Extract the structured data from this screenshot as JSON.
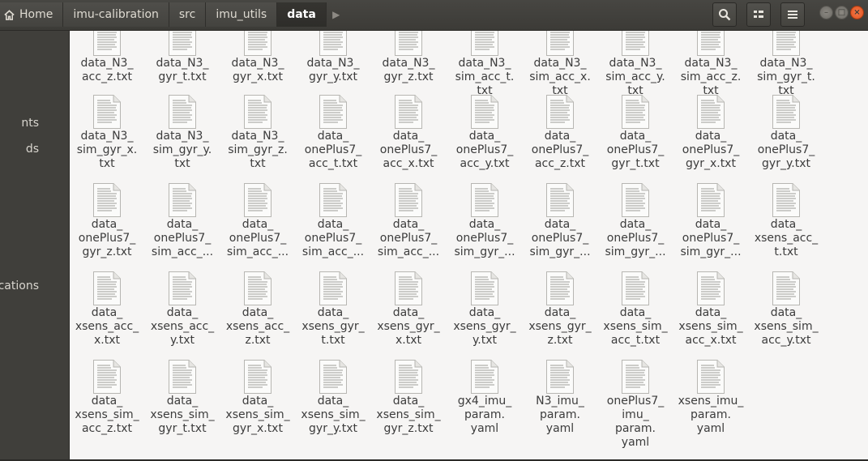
{
  "header": {
    "breadcrumbs": [
      {
        "label": "Home",
        "icon": "home-icon"
      },
      {
        "label": "imu-calibration"
      },
      {
        "label": "src"
      },
      {
        "label": "imu_utils"
      },
      {
        "label": "data",
        "active": true
      }
    ],
    "buttons": [
      {
        "name": "search-button",
        "icon": "search-icon"
      },
      {
        "name": "view-toggle-button",
        "icon": "view-list-icon"
      },
      {
        "name": "menu-button",
        "icon": "hamburger-menu-icon"
      }
    ],
    "window_controls": [
      "minimize",
      "maximize",
      "close"
    ]
  },
  "sidebar": {
    "items": [
      "nts",
      "ds",
      "cations"
    ]
  },
  "files": [
    {
      "label": "data_N3_\nacc_z.txt"
    },
    {
      "label": "data_N3_\ngyr_t.txt"
    },
    {
      "label": "data_N3_\ngyr_x.txt"
    },
    {
      "label": "data_N3_\ngyr_y.txt"
    },
    {
      "label": "data_N3_\ngyr_z.txt"
    },
    {
      "label": "data_N3_\nsim_acc_t.\ntxt"
    },
    {
      "label": "data_N3_\nsim_acc_x.\ntxt"
    },
    {
      "label": "data_N3_\nsim_acc_y.\ntxt"
    },
    {
      "label": "data_N3_\nsim_acc_z.\ntxt"
    },
    {
      "label": "data_N3_\nsim_gyr_t.\ntxt"
    },
    {
      "label": "data_N3_\nsim_gyr_x.\ntxt"
    },
    {
      "label": "data_N3_\nsim_gyr_y.\ntxt"
    },
    {
      "label": "data_N3_\nsim_gyr_z.\ntxt"
    },
    {
      "label": "data_\nonePlus7_\nacc_t.txt"
    },
    {
      "label": "data_\nonePlus7_\nacc_x.txt"
    },
    {
      "label": "data_\nonePlus7_\nacc_y.txt"
    },
    {
      "label": "data_\nonePlus7_\nacc_z.txt"
    },
    {
      "label": "data_\nonePlus7_\ngyr_t.txt"
    },
    {
      "label": "data_\nonePlus7_\ngyr_x.txt"
    },
    {
      "label": "data_\nonePlus7_\ngyr_y.txt"
    },
    {
      "label": "data_\nonePlus7_\ngyr_z.txt"
    },
    {
      "label": "data_\nonePlus7_\nsim_acc_..."
    },
    {
      "label": "data_\nonePlus7_\nsim_acc_..."
    },
    {
      "label": "data_\nonePlus7_\nsim_acc_..."
    },
    {
      "label": "data_\nonePlus7_\nsim_acc_..."
    },
    {
      "label": "data_\nonePlus7_\nsim_gyr_..."
    },
    {
      "label": "data_\nonePlus7_\nsim_gyr_..."
    },
    {
      "label": "data_\nonePlus7_\nsim_gyr_..."
    },
    {
      "label": "data_\nonePlus7_\nsim_gyr_..."
    },
    {
      "label": "data_\nxsens_acc_\nt.txt"
    },
    {
      "label": "data_\nxsens_acc_\nx.txt"
    },
    {
      "label": "data_\nxsens_acc_\ny.txt"
    },
    {
      "label": "data_\nxsens_acc_\nz.txt"
    },
    {
      "label": "data_\nxsens_gyr_\nt.txt"
    },
    {
      "label": "data_\nxsens_gyr_\nx.txt"
    },
    {
      "label": "data_\nxsens_gyr_\ny.txt"
    },
    {
      "label": "data_\nxsens_gyr_\nz.txt"
    },
    {
      "label": "data_\nxsens_sim_\nacc_t.txt"
    },
    {
      "label": "data_\nxsens_sim_\nacc_x.txt"
    },
    {
      "label": "data_\nxsens_sim_\nacc_y.txt"
    },
    {
      "label": "data_\nxsens_sim_\nacc_z.txt"
    },
    {
      "label": "data_\nxsens_sim_\ngyr_t.txt"
    },
    {
      "label": "data_\nxsens_sim_\ngyr_x.txt"
    },
    {
      "label": "data_\nxsens_sim_\ngyr_y.txt"
    },
    {
      "label": "data_\nxsens_sim_\ngyr_z.txt"
    },
    {
      "label": "gx4_imu_\nparam.\nyaml"
    },
    {
      "label": "N3_imu_\nparam.\nyaml"
    },
    {
      "label": "onePlus7_\nimu_\nparam.\nyaml"
    },
    {
      "label": "xsens_imu_\nparam.\nyaml"
    }
  ]
}
